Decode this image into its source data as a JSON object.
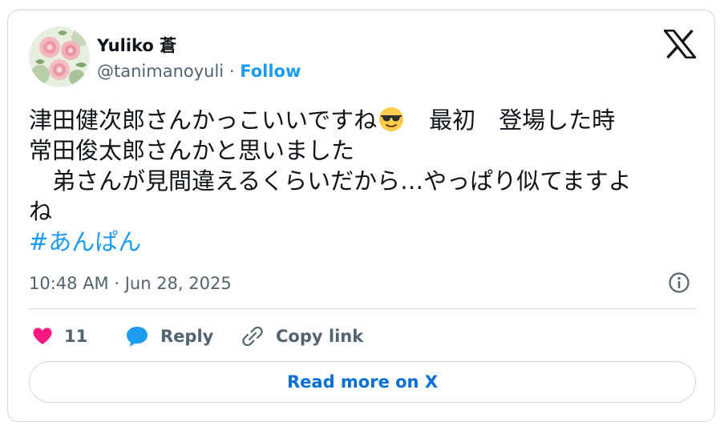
{
  "author": {
    "display_name": "Yuliko 蒼",
    "handle": "@tanimanoyuli",
    "separator": "·",
    "follow_label": "Follow"
  },
  "tweet": {
    "line1_before_emoji": "津田健次郎さんかっこいいですね",
    "emoji": "smiling-face-with-sunglasses",
    "line1_after_emoji": "　最初　登場した時",
    "line2": "常田俊太郎さんかと思いました",
    "line3": "　弟さんが見間違えるくらいだから…やっぱり似てますよ",
    "line4": "ね",
    "hashtag": "#あんぱん"
  },
  "timestamp": "10:48 AM · Jun 28, 2025",
  "actions": {
    "like_count": "11",
    "reply_label": "Reply",
    "copy_link_label": "Copy link"
  },
  "read_more_label": "Read more on X",
  "icons": {
    "logo": "x-logo-icon",
    "info": "info-icon",
    "like": "heart-icon",
    "reply": "speech-bubble-icon",
    "copy": "link-icon"
  },
  "colors": {
    "accent": "#1d9bf0",
    "read_more_text": "#006fd6",
    "like": "#f91880",
    "text_primary": "#0f1419",
    "text_secondary": "#536471",
    "border": "#cfd9de"
  }
}
